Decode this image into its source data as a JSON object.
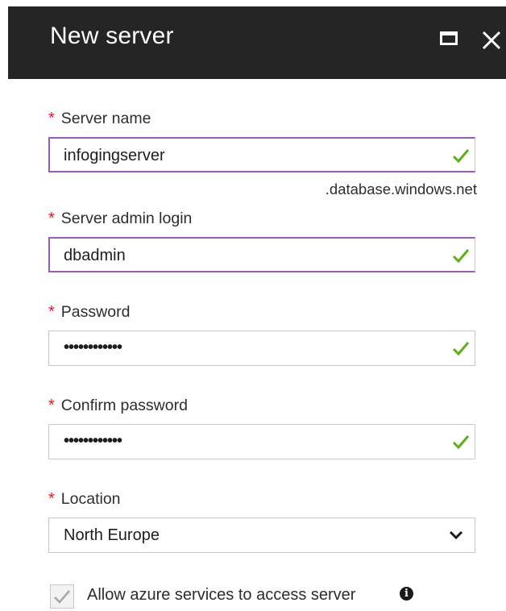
{
  "header": {
    "title": "New server",
    "maximize_icon": "maximize-icon",
    "close_icon": "close-icon",
    "background": "#252525"
  },
  "required_marker": "*",
  "accent_color": "#9b5bb0",
  "valid_color": "#5fae1a",
  "required_color": "#e81123",
  "fields": {
    "server_name": {
      "label": "Server name",
      "value": "infogingserver",
      "suffix": ".database.windows.net",
      "valid": true
    },
    "admin_login": {
      "label": "Server admin login",
      "value": "dbadmin",
      "valid": true
    },
    "password": {
      "label": "Password",
      "value": "••••••••••••",
      "valid": true
    },
    "confirm_password": {
      "label": "Confirm password",
      "value": "••••••••••••",
      "valid": true
    },
    "location": {
      "label": "Location",
      "selected": "North Europe"
    }
  },
  "allow_azure": {
    "label": "Allow azure services to access server",
    "checked": true,
    "disabled": true,
    "info_icon": "info-icon"
  }
}
